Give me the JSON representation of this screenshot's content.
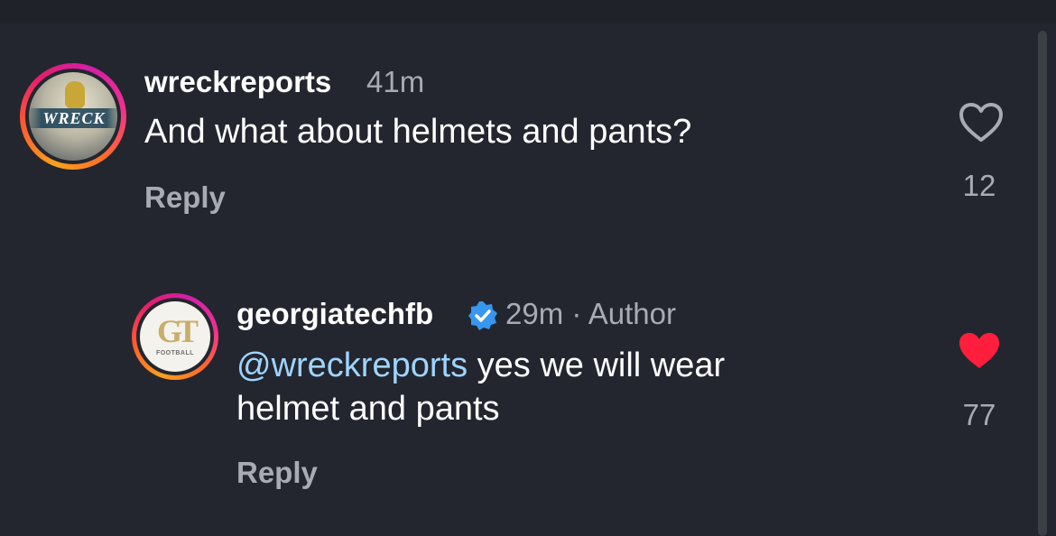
{
  "comments": [
    {
      "username": "wreckreports",
      "time": "41m",
      "text": "And what about helmets and pants?",
      "reply_label": "Reply",
      "likes": "12",
      "liked": false,
      "avatar_text": "WRECK"
    },
    {
      "username": "georgiatechfb",
      "verified": true,
      "time": "29m",
      "author_tag": "Author",
      "mention": "@wreckreports",
      "text_line1": "yes we will wear",
      "text_line2": "helmet and pants",
      "reply_label": "Reply",
      "likes": "77",
      "liked": true,
      "avatar_text": "GT",
      "avatar_subtext": "FOOTBALL"
    }
  ],
  "colors": {
    "background": "#23262e",
    "muted_text": "#a8abb3",
    "mention": "#9fd4ff",
    "like_active": "#ff1f3d",
    "verified_badge": "#3797f0"
  },
  "icons": {
    "like_outline": "heart-outline-icon",
    "like_filled": "heart-filled-icon",
    "verified": "verified-badge-icon"
  }
}
